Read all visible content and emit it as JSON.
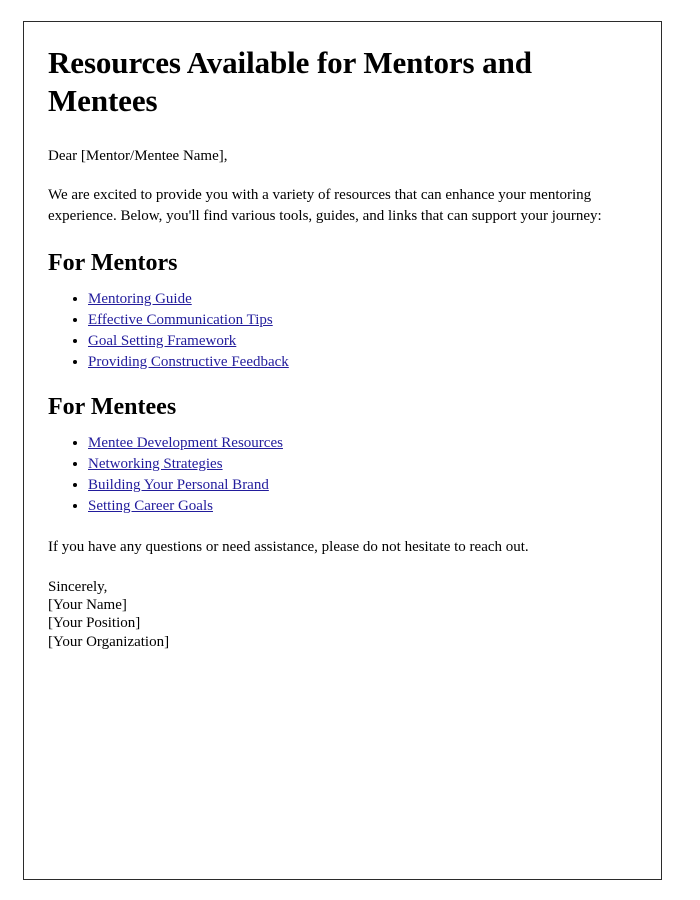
{
  "document": {
    "title": "Resources Available for Mentors and Mentees",
    "salutation": "Dear [Mentor/Mentee Name],",
    "intro_paragraph": "We are excited to provide you with a variety of resources that can enhance your mentoring experience. Below, you'll find various tools, guides, and links that can support your journey:",
    "closing_paragraph": "If you have any questions or need assistance, please do not hesitate to reach out.",
    "sections": [
      {
        "heading": "For Mentors",
        "links": [
          "Mentoring Guide",
          "Effective Communication Tips",
          "Goal Setting Framework",
          "Providing Constructive Feedback"
        ]
      },
      {
        "heading": "For Mentees",
        "links": [
          "Mentee Development Resources",
          "Networking Strategies",
          "Building Your Personal Brand",
          "Setting Career Goals"
        ]
      }
    ],
    "signature": {
      "closing": "Sincerely,",
      "name": "[Your Name]",
      "position": "[Your Position]",
      "organization": "[Your Organization]"
    }
  },
  "colors": {
    "link": "#221c9c",
    "text": "#000000",
    "page_border": "#2b2b2b",
    "page_background": "#ffffff"
  }
}
